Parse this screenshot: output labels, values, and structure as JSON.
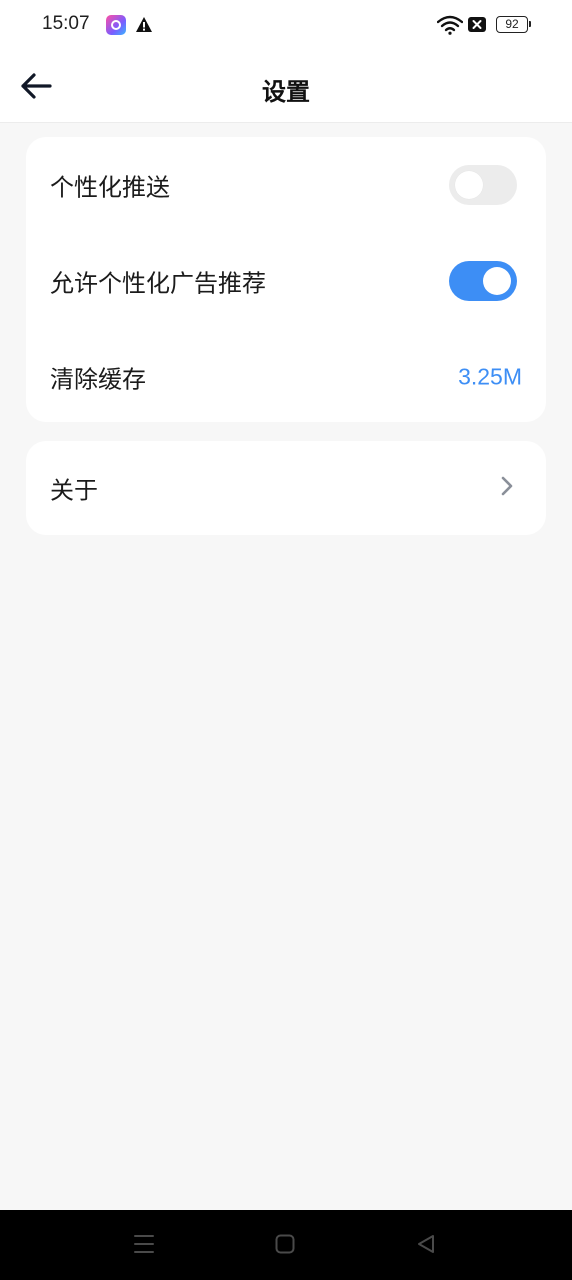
{
  "status_bar": {
    "time": "15:07",
    "battery_level": "92",
    "icons": [
      "app-notification-icon",
      "warning-icon",
      "wifi-icon",
      "no-sim-icon",
      "battery-icon"
    ]
  },
  "header": {
    "title": "设置",
    "back_icon": "arrow-left-icon"
  },
  "settings": {
    "personalized_push": {
      "label": "个性化推送",
      "enabled": false
    },
    "personalized_ads": {
      "label": "允许个性化广告推荐",
      "enabled": true
    },
    "clear_cache": {
      "label": "清除缓存",
      "value": "3.25M"
    }
  },
  "about": {
    "label": "关于",
    "icon": "chevron-right-icon"
  },
  "nav_bar": {
    "icons": [
      "menu-icon",
      "home-icon",
      "back-triangle-icon"
    ]
  },
  "colors": {
    "accent": "#3d8ef5",
    "background": "#f7f7f7",
    "card": "#ffffff",
    "toggle_off": "#ececec"
  }
}
